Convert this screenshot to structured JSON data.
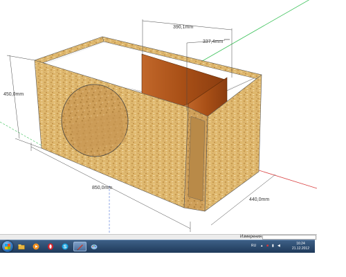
{
  "dimensions": {
    "depth_top": "390,1mm",
    "inner_partition": "337,4mm",
    "height": "450,0mm",
    "width": "850,0mm",
    "depth_side": "440,0mm"
  },
  "statusbar": {
    "measurements_label": "Измерения",
    "measurements_value": ""
  },
  "taskbar": {
    "apps": [
      {
        "name": "folder",
        "color": "#e8b640"
      },
      {
        "name": "media-player",
        "color": "#f09020"
      },
      {
        "name": "opera",
        "color": "#d8222a"
      },
      {
        "name": "skype",
        "color": "#1aa3e0"
      },
      {
        "name": "sketchup",
        "color": "#c23a2b"
      },
      {
        "name": "paint",
        "color": "#9cc7e8"
      }
    ],
    "language": "RU",
    "time": "16:24",
    "date": "21.12.2012"
  },
  "colors": {
    "osb_light": "#e7c27a",
    "osb_mid": "#d7a85e",
    "osb_dark": "#b98a48",
    "wood_partition": "#a84f16",
    "axis_red": "#d83a3a",
    "axis_green": "#3cc25a"
  }
}
